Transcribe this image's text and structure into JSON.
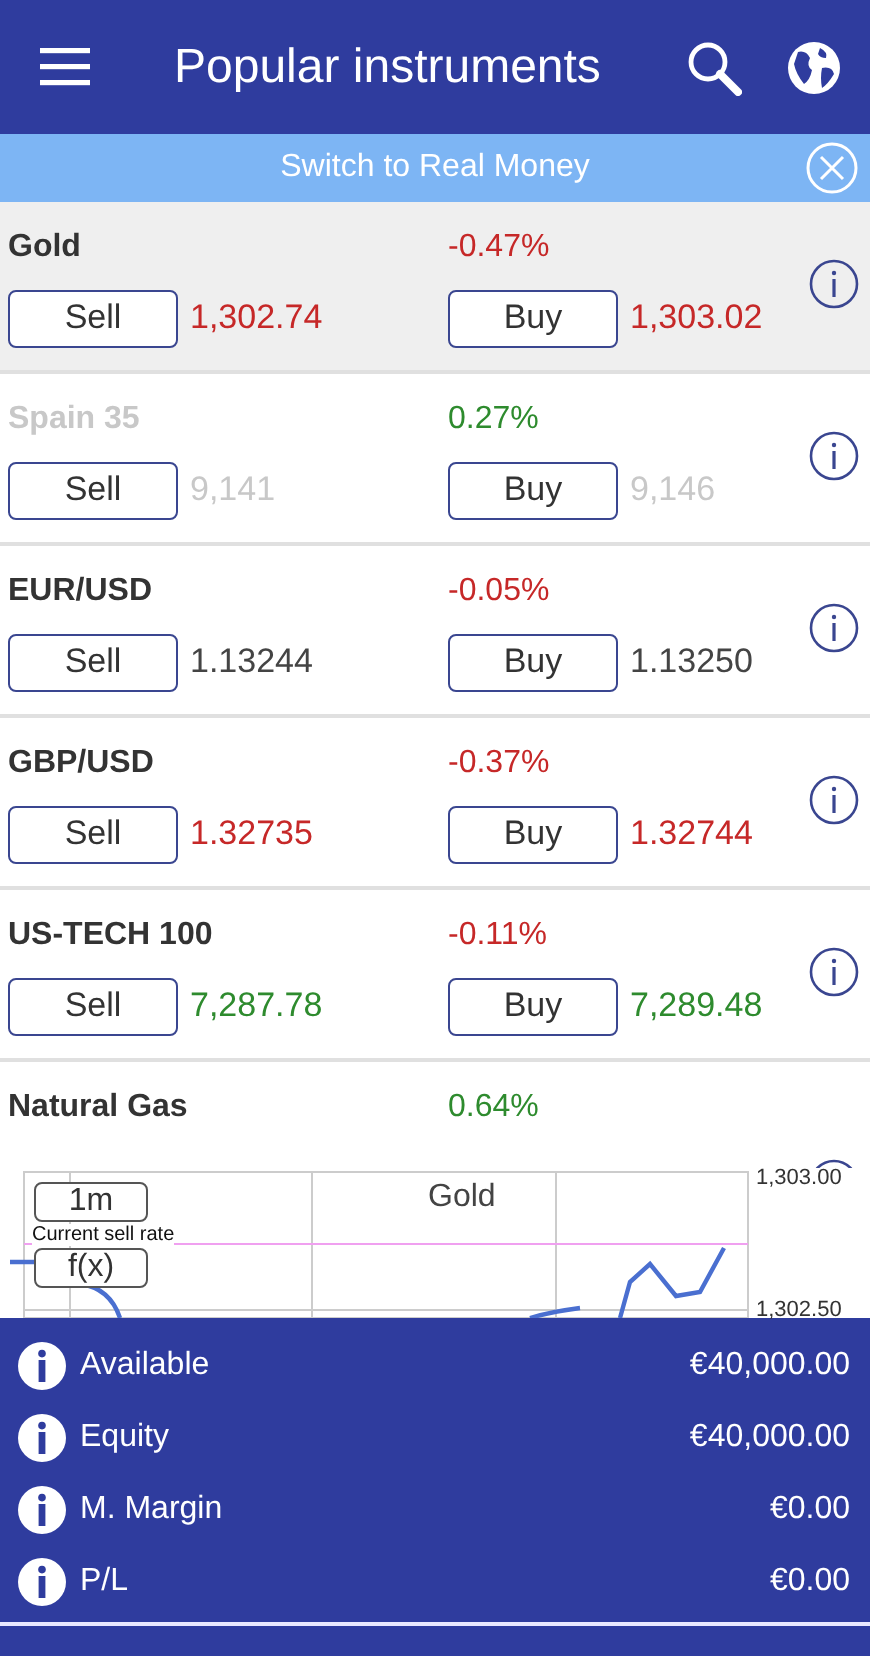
{
  "header": {
    "title": "Popular instruments"
  },
  "banner": {
    "text": "Switch to Real Money"
  },
  "instruments": [
    {
      "name": "Gold",
      "change": {
        "text": "-0.47%",
        "color": "#c62828"
      },
      "sell": {
        "label": "Sell",
        "price": "1,302.74",
        "color": "#c62828"
      },
      "buy": {
        "label": "Buy",
        "price": "1,303.02",
        "color": "#c62828"
      },
      "selected": true,
      "disabled": false
    },
    {
      "name": "Spain 35",
      "change": {
        "text": "0.27%",
        "color": "#2e8b2e"
      },
      "sell": {
        "label": "Sell",
        "price": "9,141",
        "color": "#c8c8c8"
      },
      "buy": {
        "label": "Buy",
        "price": "9,146",
        "color": "#c8c8c8"
      },
      "selected": false,
      "disabled": true
    },
    {
      "name": "EUR/USD",
      "change": {
        "text": "-0.05%",
        "color": "#c62828"
      },
      "sell": {
        "label": "Sell",
        "price": "1.13244",
        "color": "#444444"
      },
      "buy": {
        "label": "Buy",
        "price": "1.13250",
        "color": "#444444"
      },
      "selected": false,
      "disabled": false
    },
    {
      "name": "GBP/USD",
      "change": {
        "text": "-0.37%",
        "color": "#c62828"
      },
      "sell": {
        "label": "Sell",
        "price": "1.32735",
        "color": "#c62828"
      },
      "buy": {
        "label": "Buy",
        "price": "1.32744",
        "color": "#c62828"
      },
      "selected": false,
      "disabled": false
    },
    {
      "name": "US-TECH 100",
      "change": {
        "text": "-0.11%",
        "color": "#c62828"
      },
      "sell": {
        "label": "Sell",
        "price": "7,287.78",
        "color": "#2e8b2e"
      },
      "buy": {
        "label": "Buy",
        "price": "7,289.48",
        "color": "#2e8b2e"
      },
      "selected": false,
      "disabled": false
    },
    {
      "name": "Natural Gas",
      "change": {
        "text": "0.64%",
        "color": "#2e8b2e"
      },
      "selected": false,
      "disabled": false
    }
  ],
  "chart": {
    "title": "Gold",
    "period_button": "1m",
    "function_button": "f(x)",
    "line_label": "Current sell rate",
    "axis_labels": [
      "1,303.00",
      "1,302.50"
    ]
  },
  "account": [
    {
      "label": "Available",
      "value": "€40,000.00"
    },
    {
      "label": "Equity",
      "value": "€40,000.00"
    },
    {
      "label": "M. Margin",
      "value": "€0.00"
    },
    {
      "label": "P/L",
      "value": "€0.00"
    }
  ]
}
